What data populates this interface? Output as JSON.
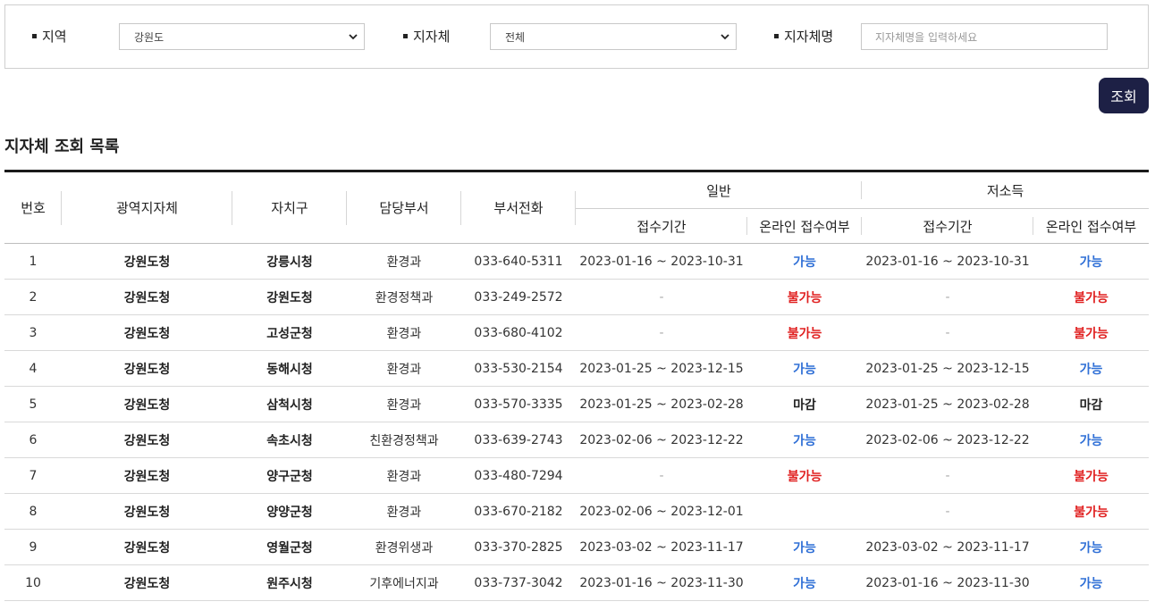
{
  "filters": {
    "region": {
      "label": "지역",
      "value": "강원도"
    },
    "municipality": {
      "label": "지자체",
      "value": "전체"
    },
    "name": {
      "label": "지자체명",
      "placeholder": "지자체명을 입력하세요"
    }
  },
  "search_button": "조회",
  "section_title": "지자체 조회 목록",
  "table": {
    "headers": {
      "no": "번호",
      "province": "광역지자체",
      "district": "자치구",
      "department": "담당부서",
      "phone": "부서전화",
      "general": "일반",
      "low_income": "저소득",
      "period": "접수기간",
      "online": "온라인 접수여부"
    },
    "rows": [
      {
        "no": "1",
        "province": "강원도청",
        "district": "강릉시청",
        "department": "환경과",
        "phone": "033-640-5311",
        "gen_period": "2023-01-16 ~ 2023-10-31",
        "gen_online": "가능",
        "gen_status": "ok",
        "low_period": "2023-01-16 ~ 2023-10-31",
        "low_online": "가능",
        "low_status": "ok"
      },
      {
        "no": "2",
        "province": "강원도청",
        "district": "강원도청",
        "department": "환경정책과",
        "phone": "033-249-2572",
        "gen_period": "-",
        "gen_online": "불가능",
        "gen_status": "no",
        "low_period": "-",
        "low_online": "불가능",
        "low_status": "no"
      },
      {
        "no": "3",
        "province": "강원도청",
        "district": "고성군청",
        "department": "환경과",
        "phone": "033-680-4102",
        "gen_period": "-",
        "gen_online": "불가능",
        "gen_status": "no",
        "low_period": "-",
        "low_online": "불가능",
        "low_status": "no"
      },
      {
        "no": "4",
        "province": "강원도청",
        "district": "동해시청",
        "department": "환경과",
        "phone": "033-530-2154",
        "gen_period": "2023-01-25 ~ 2023-12-15",
        "gen_online": "가능",
        "gen_status": "ok",
        "low_period": "2023-01-25 ~ 2023-12-15",
        "low_online": "가능",
        "low_status": "ok"
      },
      {
        "no": "5",
        "province": "강원도청",
        "district": "삼척시청",
        "department": "환경과",
        "phone": "033-570-3335",
        "gen_period": "2023-01-25 ~ 2023-02-28",
        "gen_online": "마감",
        "gen_status": "closed",
        "low_period": "2023-01-25 ~ 2023-02-28",
        "low_online": "마감",
        "low_status": "closed"
      },
      {
        "no": "6",
        "province": "강원도청",
        "district": "속초시청",
        "department": "친환경정책과",
        "phone": "033-639-2743",
        "gen_period": "2023-02-06 ~ 2023-12-22",
        "gen_online": "가능",
        "gen_status": "ok",
        "low_period": "2023-02-06 ~ 2023-12-22",
        "low_online": "가능",
        "low_status": "ok"
      },
      {
        "no": "7",
        "province": "강원도청",
        "district": "양구군청",
        "department": "환경과",
        "phone": "033-480-7294",
        "gen_period": "-",
        "gen_online": "불가능",
        "gen_status": "no",
        "low_period": "-",
        "low_online": "불가능",
        "low_status": "no"
      },
      {
        "no": "8",
        "province": "강원도청",
        "district": "양양군청",
        "department": "환경과",
        "phone": "033-670-2182",
        "gen_period": "2023-02-06 ~ 2023-12-01",
        "gen_online": "",
        "gen_status": "none",
        "low_period": "-",
        "low_online": "불가능",
        "low_status": "no"
      },
      {
        "no": "9",
        "province": "강원도청",
        "district": "영월군청",
        "department": "환경위생과",
        "phone": "033-370-2825",
        "gen_period": "2023-03-02 ~ 2023-11-17",
        "gen_online": "가능",
        "gen_status": "ok",
        "low_period": "2023-03-02 ~ 2023-11-17",
        "low_online": "가능",
        "low_status": "ok"
      },
      {
        "no": "10",
        "province": "강원도청",
        "district": "원주시청",
        "department": "기후에너지과",
        "phone": "033-737-3042",
        "gen_period": "2023-01-16 ~ 2023-11-30",
        "gen_online": "가능",
        "gen_status": "ok",
        "low_period": "2023-01-16 ~ 2023-11-30",
        "low_online": "가능",
        "low_status": "ok"
      }
    ]
  },
  "colors": {
    "button_bg": "#1d2045",
    "available": "#2f6fd6",
    "unavailable": "#e02020"
  },
  "icons": {
    "select_arrow": "chevron-down-icon",
    "label_bullet": "square-bullet-icon"
  }
}
